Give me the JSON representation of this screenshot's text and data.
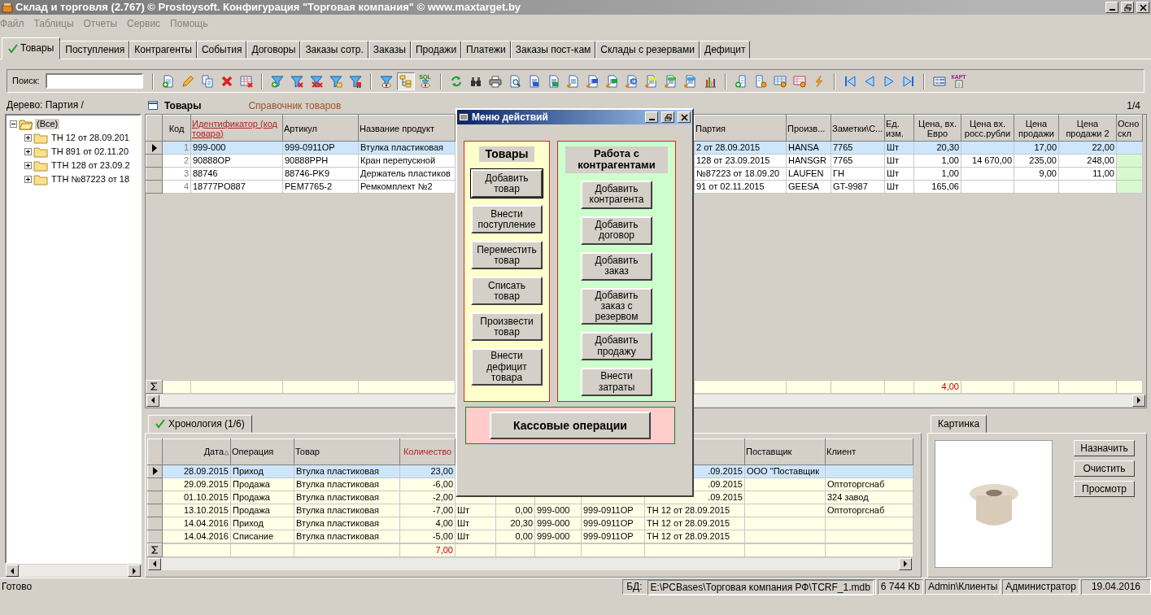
{
  "window": {
    "title": "Склад и торговля (2.767) © Prostoysoft. Конфигурация \"Торговая компания\" © www.maxtarget.by"
  },
  "menu": [
    "Файл",
    "Таблицы",
    "Отчеты",
    "Сервис",
    "Помощь"
  ],
  "tabs": [
    {
      "label": "Товары",
      "selected": true
    },
    {
      "label": "Поступления",
      "selected": false
    },
    {
      "label": "Контрагенты",
      "selected": false
    },
    {
      "label": "События",
      "selected": false
    },
    {
      "label": "Договоры",
      "selected": false
    },
    {
      "label": "Заказы сотр.",
      "selected": false
    },
    {
      "label": "Заказы",
      "selected": false
    },
    {
      "label": "Продажи",
      "selected": false
    },
    {
      "label": "Платежи",
      "selected": false
    },
    {
      "label": "Заказы пост-кам",
      "selected": false
    },
    {
      "label": "Склады с резервами",
      "selected": false
    },
    {
      "label": "Дефицит",
      "selected": false
    }
  ],
  "toolbar": {
    "search_label": "Поиск:",
    "sql_badge": "SQL",
    "card_badge": "КАРТ",
    "tree_view_pressed": true
  },
  "tree": {
    "label": "Дерево: Партия /",
    "nodes": [
      {
        "label": "(Все)",
        "expanded": true,
        "selected": true,
        "children": [
          {
            "label": "ТН 12 от 28.09.201",
            "expanded": false,
            "selected": false
          },
          {
            "label": "ТН 891 от 02.11.20",
            "expanded": false,
            "selected": false
          },
          {
            "label": "ТТН 128 от 23.09.2",
            "expanded": false,
            "selected": false
          },
          {
            "label": "ТТН №87223 от 18",
            "expanded": false,
            "selected": false
          }
        ]
      }
    ]
  },
  "products": {
    "title": "Товары",
    "subtitle": "Справочник товаров",
    "counter": "1/4",
    "columns": [
      {
        "label": "Код",
        "accent": false
      },
      {
        "label": "Идентификатор (код товара)",
        "accent": true
      },
      {
        "label": "Артикул",
        "accent": false
      },
      {
        "label": "Название продукт",
        "accent": false
      },
      {
        "label": "Партия",
        "accent": false
      },
      {
        "label": "Произв...",
        "accent": false
      },
      {
        "label": "Заметки\\С...",
        "accent": false
      },
      {
        "label": "Ед. изм.",
        "accent": false
      },
      {
        "label": "Цена, вх. Евро",
        "accent": false,
        "total": "4,00"
      },
      {
        "label": "Цена вх. росс.рубли",
        "accent": false
      },
      {
        "label": "Цена продажи",
        "accent": false
      },
      {
        "label": "Цена продажи 2",
        "accent": false
      },
      {
        "label": "Осно скл",
        "accent": false
      }
    ],
    "rows": [
      {
        "selected": true,
        "marked": false,
        "cells": [
          "1",
          "999-000",
          "999-0911OP",
          "Втулка пластиковая",
          "2 от 28.09.2015",
          "HANSA",
          "7765",
          "Шт",
          "20,30",
          null,
          "17,00",
          "22,00",
          null
        ]
      },
      {
        "selected": false,
        "marked": true,
        "cells": [
          "2",
          "90888OP",
          "90888PPH",
          "Кран перепускной",
          "128 от 23.09.2015",
          "HANSGR",
          "7765",
          "Шт",
          "1,00",
          "14 670,00",
          "235,00",
          "248,00",
          null
        ]
      },
      {
        "selected": false,
        "marked": true,
        "cells": [
          "3",
          "88746",
          "88746-PK9",
          "Держатель пластиков",
          "№87223 от 18.09.20",
          "LAUFEN",
          "ГН",
          "Шт",
          "1,00",
          null,
          "9,00",
          "11,00",
          null
        ]
      },
      {
        "selected": false,
        "marked": true,
        "cells": [
          "4",
          "18777PO887",
          "PEM7765-2",
          "Ремкомплект №2",
          "91 от 02.11.2015",
          "GEESA",
          "GT-9987",
          "Шт",
          "165,06",
          null,
          null,
          null,
          null
        ]
      }
    ]
  },
  "history": {
    "tab": {
      "label": "Хронология (1/6)",
      "selected": true
    },
    "columns": [
      {
        "label": "Дата",
        "accent": false,
        "sorted": true
      },
      {
        "label": "Операция",
        "accent": false
      },
      {
        "label": "Товар",
        "accent": false
      },
      {
        "label": "Количество",
        "accent": true,
        "total": "7,00"
      },
      {},
      {},
      {},
      {},
      {},
      {
        "label": "Поставщик",
        "accent": false
      },
      {
        "label": "Клиент",
        "accent": false
      }
    ],
    "rows": [
      {
        "selected": true,
        "cells": [
          "28.09.2015",
          "Приход",
          "Втулка пластиковая",
          "23,00",
          null,
          null,
          null,
          null,
          ".09.2015",
          "ООО \"Поставщик",
          null
        ]
      },
      {
        "selected": false,
        "cells": [
          "29.09.2015",
          "Продажа",
          "Втулка пластиковая",
          "-6,00",
          null,
          null,
          null,
          null,
          ".09.2015",
          null,
          "Оптоторгснаб"
        ]
      },
      {
        "selected": false,
        "cells": [
          "01.10.2015",
          "Продажа",
          "Втулка пластиковая",
          "-2,00",
          null,
          null,
          null,
          null,
          ".09.2015",
          null,
          "324 завод"
        ]
      },
      {
        "selected": false,
        "cells": [
          "13.10.2015",
          "Продажа",
          "Втулка пластиковая",
          "-7,00",
          "Шт",
          "0,00",
          "999-000",
          "999-0911OP",
          "ТН 12 от 28.09.2015",
          null,
          "Оптоторгснаб"
        ]
      },
      {
        "selected": false,
        "cells": [
          "14.04.2016",
          "Приход",
          "Втулка пластиковая",
          "4,00",
          "Шт",
          "20,30",
          "999-000",
          "999-0911OP",
          "ТН 12 от 28.09.2015",
          null,
          null
        ]
      },
      {
        "selected": false,
        "cells": [
          "14.04.2016",
          "Списание",
          "Втулка пластиковая",
          "-5,00",
          "Шт",
          "0,00",
          "999-000",
          "999-0911OP",
          "ТН 12 от 28.09.2015",
          null,
          null
        ]
      }
    ]
  },
  "picture": {
    "tab": "Картинка",
    "buttons": [
      "Назначить",
      "Очистить",
      "Просмотр"
    ]
  },
  "dialog": {
    "title": "Меню действий",
    "groups": [
      {
        "title": "Товары",
        "color": "#ffffcc",
        "buttons": [
          {
            "label": "Добавить товар",
            "focused": true
          },
          {
            "label": "Внести поступление",
            "focused": false
          },
          {
            "label": "Переместить товар",
            "focused": false
          },
          {
            "label": "Списать товар",
            "focused": false
          },
          {
            "label": "Произвести товар",
            "focused": false
          },
          {
            "label": "Внести дефицит товара",
            "focused": false
          }
        ]
      },
      {
        "title": "Работа с контрагентами",
        "color": "#ccffcc",
        "buttons": [
          {
            "label": "Добавить контрагента",
            "focused": false
          },
          {
            "label": "Добавить договор",
            "focused": false
          },
          {
            "label": "Добавить заказ",
            "focused": false
          },
          {
            "label": "Добавить заказ с резервом",
            "focused": false
          },
          {
            "label": "Добавить продажу",
            "focused": false
          },
          {
            "label": "Внести затраты",
            "focused": false
          }
        ]
      }
    ],
    "cash_button": "Кассовые операции"
  },
  "status_bar": {
    "message": "Готово",
    "db_label": "БД:",
    "db_path": "E:\\PCBases\\Торговая компания РФ\\TCRF_1.mdb",
    "db_size": "6 744 Kb",
    "user_path": "Admin\\Клиенты",
    "role": "Администратор",
    "date": "19.04.2016"
  }
}
